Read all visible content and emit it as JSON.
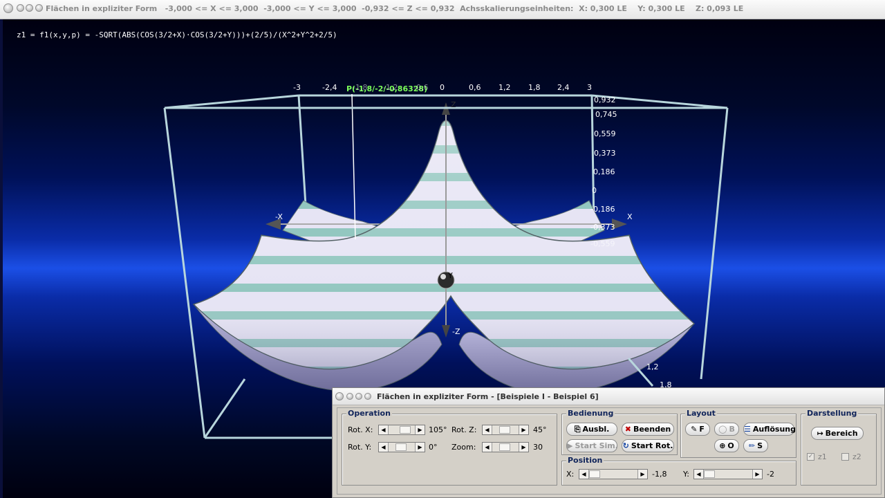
{
  "window": {
    "title": "Flächen in expliziter Form   -3,000 <= X <= 3,000  -3,000 <= Y <= 3,000  -0,932 <= Z <= 0,932  Achsskalierungseinheiten:  X: 0,300 LE    Y: 0,300 LE    Z: 0,093 LE"
  },
  "plot": {
    "formula": "z1 = f1(x,y,p) = -SQRT(ABS(COS(3/2+X)·COS(3/2+Y)))+(2/5)/(X^2+Y^2+2/5)",
    "point_label": "P(-1,8/-2/-0,86328)",
    "x_ticks": [
      "-3",
      "-2,4",
      "-1,8",
      "-1,2",
      "-0,6",
      "0",
      "0,6",
      "1,2",
      "1,8",
      "2,4",
      "3"
    ],
    "z_ticks": [
      "0,932",
      "0,745",
      "0,559",
      "0,373",
      "0,186",
      "0",
      "-0,186",
      "-0,373",
      "-0,559"
    ],
    "y_ticks": [
      "1,2",
      "1,8"
    ],
    "axis_x_pos": "X",
    "axis_x_neg": "-X",
    "axis_y": "Y",
    "axis_z_pos": "Z",
    "axis_z_neg": "-Z",
    "colors": {
      "surface_light": "#e6e4f4",
      "surface_stripe": "#93c7c0",
      "box": "#b8d6dc"
    }
  },
  "dialog": {
    "title": "Flächen in expliziter Form - [Beispiele I - Beispiel 6]",
    "operation": {
      "title": "Operation",
      "rot_x_label": "Rot. X:",
      "rot_x_value": "105°",
      "rot_z_label": "Rot. Z:",
      "rot_z_value": "45°",
      "rot_y_label": "Rot. Y:",
      "rot_y_value": "0°",
      "zoom_label": "Zoom:",
      "zoom_value": "30"
    },
    "bedienung": {
      "title": "Bedienung",
      "ausbl": "Ausbl.",
      "beenden": "Beenden",
      "start_sim": "Start Sim.",
      "start_rot": "Start Rot."
    },
    "layout": {
      "title": "Layout",
      "f": "F",
      "b": "B",
      "aufloesung": "Auflösung",
      "o": "O",
      "s": "S"
    },
    "position": {
      "title": "Position",
      "x_label": "X:",
      "x_value": "-1,8",
      "y_label": "Y:",
      "y_value": "-2"
    },
    "darstellung": {
      "title": "Darstellung",
      "bereich": "Bereich",
      "z1": "z1",
      "z2": "z2"
    }
  }
}
